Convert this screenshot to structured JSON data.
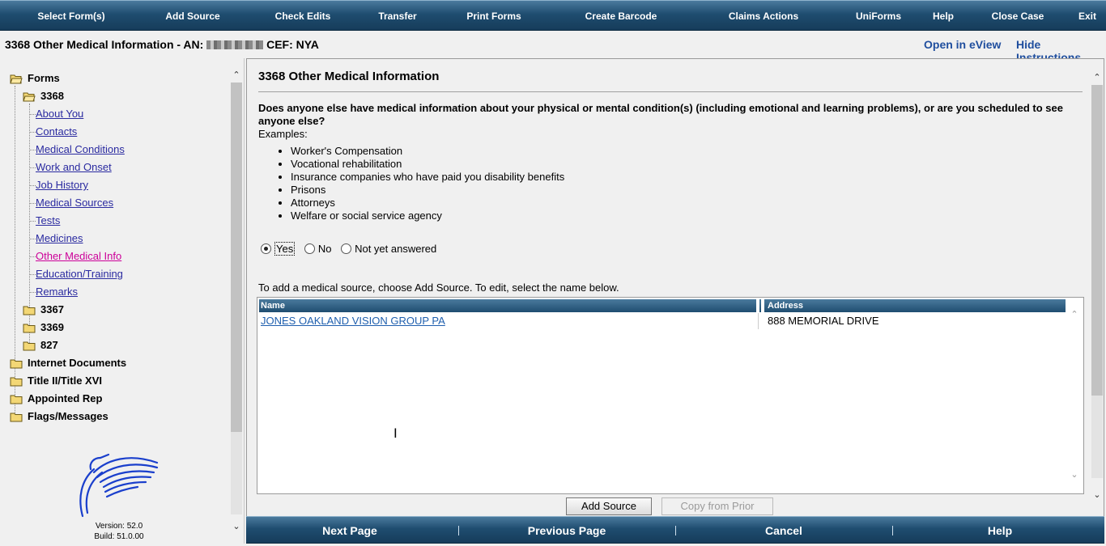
{
  "toolbar": {
    "items": [
      {
        "label": "Select Form(s)",
        "icon": ""
      },
      {
        "label": "Add Source"
      },
      {
        "label": "Check Edits"
      },
      {
        "label": "Transfer"
      },
      {
        "label": "Print Forms"
      },
      {
        "label": "Create Barcode"
      },
      {
        "label": "Claims Actions"
      },
      {
        "label": "UniForms"
      },
      {
        "label": "Help"
      },
      {
        "label": "Close Case"
      },
      {
        "label": "Exit"
      }
    ]
  },
  "header": {
    "title_prefix": "3368 Other Medical Information - AN:",
    "title_suffix": "CEF: NYA",
    "open_eview": "Open in eView",
    "hide_instructions": "Hide Instructions"
  },
  "sidebar": {
    "forms_label": "Forms",
    "form_3368": "3368",
    "links": [
      "About You",
      "Contacts",
      "Medical Conditions",
      "Work and Onset",
      "Job History",
      "Medical Sources",
      "Tests",
      "Medicines",
      "Other Medical Info",
      "Education/Training",
      "Remarks"
    ],
    "active_link": "Other Medical Info",
    "sub_forms": [
      "3367",
      "3369",
      "827"
    ],
    "top_folders": [
      "Internet Documents",
      "Title II/Title XVI",
      "Appointed Rep",
      "Flags/Messages"
    ],
    "logo_icon": "ssa-eagle-icon",
    "version": "Version: 52.0",
    "build": "Build: 51.0.00"
  },
  "main": {
    "section_title": "3368 Other Medical Information",
    "question": "Does anyone else have medical information about your physical or mental condition(s) (including emotional and learning problems), or are you scheduled to see anyone else?",
    "examples_label": "Examples:",
    "examples": [
      "Worker's Compensation",
      "Vocational rehabilitation",
      "Insurance companies who have paid you disability benefits",
      "Prisons",
      "Attorneys",
      "Welfare or social service agency"
    ],
    "radio_options": [
      "Yes",
      "No",
      "Not yet answered"
    ],
    "radio_selected": "Yes",
    "add_hint": "To add a medical source, choose Add Source. To edit, select the name below.",
    "grid": {
      "columns": [
        "Name",
        "Address"
      ],
      "rows": [
        {
          "name": "JONES OAKLAND VISION GROUP PA",
          "address": "888 MEMORIAL DRIVE"
        }
      ]
    },
    "add_source_button": "Add Source",
    "copy_prior_button": "Copy from Prior"
  },
  "bottombar": {
    "items": [
      "Next Page",
      "Previous Page",
      "Cancel",
      "Help"
    ]
  },
  "colors": {
    "bar": "#1f4d70",
    "link": "#2a2aa0",
    "active_link": "#cc0099",
    "header_link": "#1f4e9e"
  }
}
